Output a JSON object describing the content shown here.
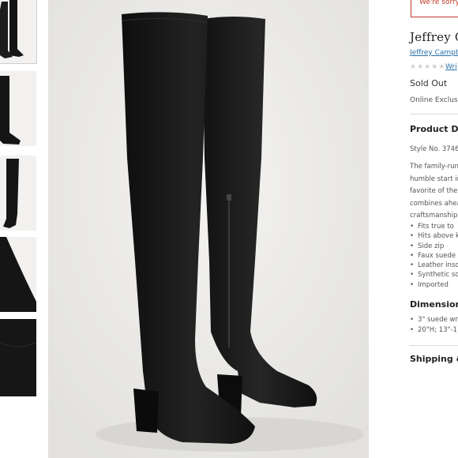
{
  "notice": {
    "text": "We're sorry."
  },
  "product": {
    "title": "Jeffrey C",
    "brand_link": "Jeffrey Campbe",
    "rating_stars": "★★★★★",
    "write_review_link": "Wri",
    "availability": "Sold Out",
    "channel": "Online Exclusiv"
  },
  "details": {
    "heading": "Product Deta",
    "style_no": "Style No. 3746",
    "description_lines": [
      "The family-run",
      "humble start in",
      "favorite of the",
      "combines ahea",
      "craftsmanship."
    ],
    "features": [
      "Fits true to",
      "Hits above k",
      "Side zip",
      "Faux suede",
      "Leather inso",
      "Synthetic so",
      "Imported"
    ]
  },
  "dimensions": {
    "heading": "Dimensions",
    "items": [
      "3\" suede wr",
      "20\"H; 13\"-1"
    ]
  },
  "shipping": {
    "heading": "Shipping & R"
  },
  "icons": {
    "zoom": "zoom-icon",
    "thumbnails": [
      "boot-pair-front",
      "boot-side",
      "boot-side-standing",
      "boot-toe-closeup",
      "boot-heel-closeup"
    ]
  },
  "colors": {
    "link": "#2a6fa8",
    "notice_border": "#c0392b",
    "image_bg": "#ecebe8",
    "boot": "#151515"
  }
}
